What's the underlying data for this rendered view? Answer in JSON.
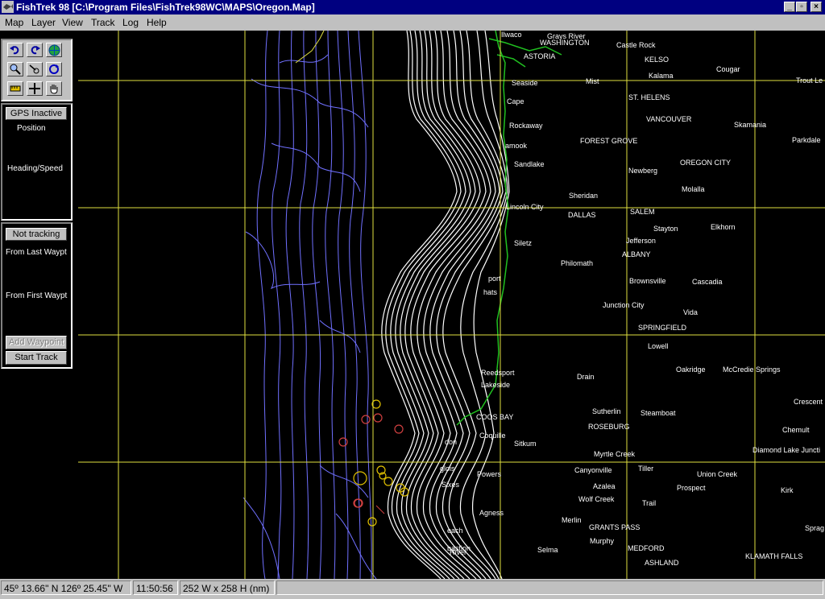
{
  "window": {
    "title": "FishTrek 98 [C:\\Program Files\\FishTrek98WC\\MAPS\\Oregon.Map]"
  },
  "menu": [
    "Map",
    "Layer",
    "View",
    "Track",
    "Log",
    "Help"
  ],
  "toolbar": {
    "tools": [
      "undo-icon",
      "redo-icon",
      "globe-icon",
      "zoom-icon",
      "measure-icon",
      "refresh-icon",
      "ruler-icon",
      "crosshair-icon",
      "hand-pan-icon"
    ]
  },
  "gps": {
    "status_button": "GPS Inactive",
    "position_label": "Position",
    "heading_label": "Heading/Speed"
  },
  "track": {
    "status_button": "Not tracking",
    "from_last_label": "From Last Waypt",
    "from_first_label": "From First Waypt",
    "add_waypoint_button": "Add Waypoint",
    "start_track_button": "Start Track"
  },
  "map": {
    "colors": {
      "background": "#000000",
      "grid": "#e0e040",
      "bathymetry_deep": "#7070ff",
      "bathymetry_shallow": "#ffffff",
      "coastline": "#20c020",
      "place_label": "#ffffff"
    },
    "places": {
      "ilwaco": "Ilwaco",
      "grays_river": "Grays River",
      "washington": "WASHINGTON",
      "castle_rock": "Castle Rock",
      "astoria": "ASTORIA",
      "kelso": "KELSO",
      "kalama": "Kalama",
      "cougar": "Cougar",
      "seaside": "Seaside",
      "mist": "Mist",
      "trout_lake": "Trout Le",
      "cape": "Cape",
      "st_helens": "ST. HELENS",
      "rockaway": "Rockaway",
      "vancouver": "VANCOUVER",
      "skamania": "Skamania",
      "tillamook": "amook",
      "forest_grove": "FOREST GROVE",
      "parkdale": "Parkdale",
      "sandlake": "Sandlake",
      "newberg": "Newberg",
      "oregon_city": "OREGON CITY",
      "molalla": "Molalla",
      "sheridan": "Sheridan",
      "lincoln_city": "Lincoln City",
      "dallas": "DALLAS",
      "salem": "SALEM",
      "stayton": "Stayton",
      "elkhorn": "Elkhorn",
      "siletz": "Siletz",
      "jefferson": "Jefferson",
      "albany": "ALBANY",
      "philomath": "Philomath",
      "newport": "port",
      "brownsville": "Brownsville",
      "cascadia": "Cascadia",
      "yachats": "hats",
      "junction_city": "Junction City",
      "vida": "Vida",
      "springfield": "SPRINGFIELD",
      "lowell": "Lowell",
      "reedsport": "Reedsport",
      "oakridge": "Oakridge",
      "mccredie": "McCredie Springs",
      "drain": "Drain",
      "lakeside": "Lakeside",
      "sutherlin": "Sutherlin",
      "steamboat": "Steamboat",
      "crescent": "Crescent",
      "coos_bay": "COOS BAY",
      "roseburg": "ROSEBURG",
      "chemult": "Chemult",
      "bandon": "don",
      "coquille": "Coquille",
      "sitkum": "Sitkum",
      "myrtle_creek": "Myrtle Creek",
      "diamond_lake": "Diamond Lake Juncti",
      "langlois": "glois",
      "canyonville": "Canyonville",
      "tiller": "Tiller",
      "union_creek": "Union Creek",
      "powers": "Powers",
      "port_orford": "Sixes",
      "azalea": "Azalea",
      "prospect": "Prospect",
      "kirk": "Kirk",
      "wolf_creek": "Wolf Creek",
      "trail": "Trail",
      "agness": "Agness",
      "merlin": "Merlin",
      "grants_pass": "GRANTS PASS",
      "sprague": "Sprag",
      "gold_beach": "each",
      "murphy": "Murphy",
      "medford": "MEDFORD",
      "klamath_falls": "KLAMATH FALLS",
      "selma": "Selma",
      "ashland": "ASHLAND",
      "brookings": "River",
      "pistol": "bastion"
    }
  },
  "status": {
    "coordinates": "45º 13.66\" N 126º 25.45\" W",
    "time": "11:50:56",
    "extent": "252 W x 258 H (nm)"
  }
}
